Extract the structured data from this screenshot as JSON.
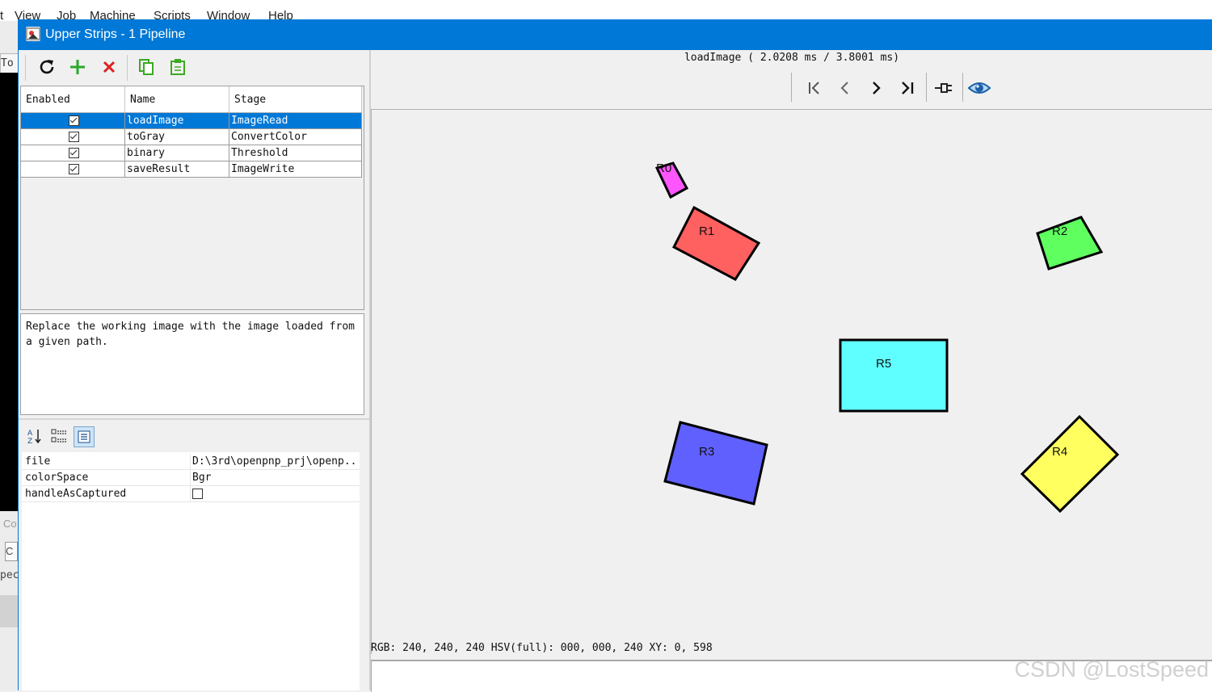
{
  "background_app": {
    "menu": [
      "t",
      "View",
      "Job",
      "Machine",
      "Scripts",
      "Window",
      "Help"
    ],
    "tab_fragment": "To",
    "co_fragment": "Co",
    "c_fragment": "C",
    "spec_fragment": "pec"
  },
  "window": {
    "title": "Upper Strips - 1 Pipeline",
    "title_color": "#0078d7"
  },
  "toolbar": {
    "buttons": [
      "refresh-icon",
      "add-icon",
      "delete-icon",
      "copy-icon",
      "paste-icon"
    ]
  },
  "stages_table": {
    "headers": [
      "Enabled",
      "Name",
      "Stage"
    ],
    "rows": [
      {
        "enabled": true,
        "name": "loadImage",
        "stage": "ImageRead",
        "selected": true
      },
      {
        "enabled": true,
        "name": "toGray",
        "stage": "ConvertColor",
        "selected": false
      },
      {
        "enabled": true,
        "name": "binary",
        "stage": "Threshold",
        "selected": false
      },
      {
        "enabled": true,
        "name": "saveResult",
        "stage": "ImageWrite",
        "selected": false
      }
    ]
  },
  "description": "Replace the working image with the image loaded from a given path.",
  "properties": {
    "toolbar": [
      "sort-alpha-icon",
      "categorized-icon",
      "description-icon"
    ],
    "rows": [
      {
        "key": "file",
        "value": "D:\\3rd\\openpnp_prj\\openp..",
        "type": "text"
      },
      {
        "key": "colorSpace",
        "value": "Bgr",
        "type": "text"
      },
      {
        "key": "handleAsCaptured",
        "value": false,
        "type": "checkbox"
      }
    ]
  },
  "viewer": {
    "timing": "loadImage ( 2.0208 ms / 3.8001 ms)",
    "nav": [
      "first-icon",
      "prev-icon",
      "next-icon",
      "last-icon",
      "pin-icon",
      "eye-icon"
    ],
    "status": "RGB: 240, 240, 240 HSV(full): 000, 000, 240 XY: 0, 598",
    "shapes": [
      {
        "label": "R0",
        "fill": "#ff55ff"
      },
      {
        "label": "R1",
        "fill": "#ff6060"
      },
      {
        "label": "R2",
        "fill": "#60ff60"
      },
      {
        "label": "R3",
        "fill": "#6060ff"
      },
      {
        "label": "R4",
        "fill": "#ffff60"
      },
      {
        "label": "R5",
        "fill": "#60ffff"
      }
    ]
  },
  "watermark": "CSDN @LostSpeed"
}
